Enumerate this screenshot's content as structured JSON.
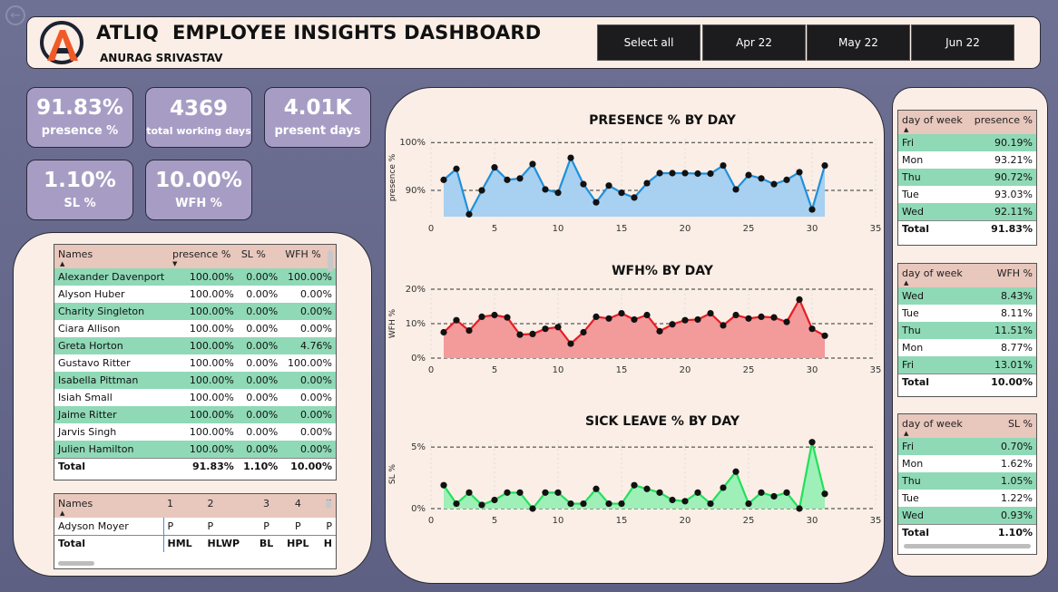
{
  "header": {
    "title": "ATLIQ  EMPLOYEE INSIGHTS DASHBOARD",
    "author": "ANURAG SRIVASTAV",
    "slicers": [
      "Select all",
      "Apr 22",
      "May 22",
      "Jun 22"
    ]
  },
  "kpis": [
    {
      "value": "91.83%",
      "label": "presence %"
    },
    {
      "value": "4369",
      "label": "total working days"
    },
    {
      "value": "4.01K",
      "label": "present days"
    },
    {
      "value": "1.10%",
      "label": "SL %"
    },
    {
      "value": "10.00%",
      "label": "WFH %"
    }
  ],
  "employee_table": {
    "columns": [
      "Names",
      "presence %",
      "SL %",
      "WFH %"
    ],
    "rows": [
      [
        "Alexander Davenport",
        "100.00%",
        "0.00%",
        "100.00%"
      ],
      [
        "Alyson Huber",
        "100.00%",
        "0.00%",
        "0.00%"
      ],
      [
        "Charity Singleton",
        "100.00%",
        "0.00%",
        "0.00%"
      ],
      [
        "Ciara Allison",
        "100.00%",
        "0.00%",
        "0.00%"
      ],
      [
        "Greta Horton",
        "100.00%",
        "0.00%",
        "4.76%"
      ],
      [
        "Gustavo Ritter",
        "100.00%",
        "0.00%",
        "100.00%"
      ],
      [
        "Isabella Pittman",
        "100.00%",
        "0.00%",
        "0.00%"
      ],
      [
        "Isiah Small",
        "100.00%",
        "0.00%",
        "0.00%"
      ],
      [
        "Jaime Ritter",
        "100.00%",
        "0.00%",
        "0.00%"
      ],
      [
        "Jarvis Singh",
        "100.00%",
        "0.00%",
        "0.00%"
      ],
      [
        "Julien Hamilton",
        "100.00%",
        "0.00%",
        "0.00%"
      ]
    ],
    "total": [
      "Total",
      "91.83%",
      "1.10%",
      "10.00%"
    ]
  },
  "attendance_matrix": {
    "columns": [
      "Names",
      "1",
      "2",
      "3",
      "4",
      "5"
    ],
    "rows": [
      [
        "Adyson Moyer",
        "P",
        "P",
        "P",
        "P",
        "P"
      ]
    ],
    "total": [
      "Total",
      "HML",
      "HLWP",
      "BL",
      "HPL",
      "H"
    ]
  },
  "dow_tables": [
    {
      "columns": [
        "day of week",
        "presence %"
      ],
      "rows": [
        [
          "Fri",
          "90.19%"
        ],
        [
          "Mon",
          "93.21%"
        ],
        [
          "Thu",
          "90.72%"
        ],
        [
          "Tue",
          "93.03%"
        ],
        [
          "Wed",
          "92.11%"
        ]
      ],
      "total": [
        "Total",
        "91.83%"
      ]
    },
    {
      "columns": [
        "day of week",
        "WFH %"
      ],
      "rows": [
        [
          "Wed",
          "8.43%"
        ],
        [
          "Tue",
          "8.11%"
        ],
        [
          "Thu",
          "11.51%"
        ],
        [
          "Mon",
          "8.77%"
        ],
        [
          "Fri",
          "13.01%"
        ]
      ],
      "total": [
        "Total",
        "10.00%"
      ]
    },
    {
      "columns": [
        "day of week",
        "SL %"
      ],
      "rows": [
        [
          "Fri",
          "0.70%"
        ],
        [
          "Mon",
          "1.62%"
        ],
        [
          "Thu",
          "1.05%"
        ],
        [
          "Tue",
          "1.22%"
        ],
        [
          "Wed",
          "0.93%"
        ]
      ],
      "total": [
        "Total",
        "1.10%"
      ]
    }
  ],
  "chart_data": [
    {
      "type": "area",
      "title": "PRESENCE % BY DAY",
      "ylabel": "presence %",
      "xlabel": "",
      "xticks": [
        0,
        5,
        10,
        15,
        20,
        25,
        30,
        35
      ],
      "yticks": [
        {
          "v": 90,
          "label": "90%"
        },
        {
          "v": 100,
          "label": "100%"
        }
      ],
      "xlim": [
        0,
        35
      ],
      "ylim": [
        84.5,
        100.8
      ],
      "grid": "horizontal dashed",
      "color": "#1e90dc",
      "fill": "#a8d0f0",
      "x": [
        1,
        2,
        3,
        4,
        5,
        6,
        7,
        8,
        9,
        10,
        11,
        12,
        13,
        14,
        15,
        16,
        17,
        18,
        19,
        20,
        21,
        22,
        23,
        24,
        25,
        26,
        27,
        28,
        29,
        30,
        31
      ],
      "values": [
        92.2,
        94.5,
        85.0,
        90.0,
        94.8,
        92.2,
        92.5,
        95.5,
        90.2,
        89.5,
        96.8,
        91.3,
        87.5,
        91.0,
        89.5,
        88.5,
        91.5,
        93.6,
        93.6,
        93.6,
        93.5,
        93.5,
        95.2,
        90.2,
        93.2,
        92.5,
        91.3,
        92.2,
        93.8,
        86.0,
        95.2
      ]
    },
    {
      "type": "area",
      "title": "WFH% BY DAY",
      "ylabel": "WFH %",
      "xlabel": "",
      "xticks": [
        0,
        5,
        10,
        15,
        20,
        25,
        30,
        35
      ],
      "yticks": [
        {
          "v": 0,
          "label": "0%"
        },
        {
          "v": 10,
          "label": "10%"
        },
        {
          "v": 20,
          "label": "20%"
        }
      ],
      "xlim": [
        0,
        35
      ],
      "ylim": [
        0,
        20
      ],
      "grid": "horizontal dashed",
      "color": "#e81c24",
      "fill": "#f39a9a",
      "x": [
        1,
        2,
        3,
        4,
        5,
        6,
        7,
        8,
        9,
        10,
        11,
        12,
        13,
        14,
        15,
        16,
        17,
        18,
        19,
        20,
        21,
        22,
        23,
        24,
        25,
        26,
        27,
        28,
        29,
        30,
        31
      ],
      "values": [
        7.5,
        11.0,
        8.0,
        12.0,
        12.5,
        11.8,
        6.8,
        7.0,
        8.5,
        9.0,
        4.2,
        7.5,
        12.0,
        11.5,
        13.0,
        11.2,
        12.5,
        7.8,
        9.8,
        11.0,
        11.2,
        13.0,
        9.5,
        12.5,
        11.5,
        12.0,
        11.8,
        10.5,
        17.0,
        8.5,
        6.5
      ]
    },
    {
      "type": "area",
      "title": "SICK LEAVE % BY DAY",
      "ylabel": "SL %",
      "xlabel": "",
      "xticks": [
        0,
        5,
        10,
        15,
        20,
        25,
        30,
        35
      ],
      "yticks": [
        {
          "v": 0,
          "label": "0%"
        },
        {
          "v": 5,
          "label": "5%"
        }
      ],
      "xlim": [
        0,
        35
      ],
      "ylim": [
        0,
        5.6
      ],
      "grid": "horizontal dashed",
      "color": "#22e05a",
      "fill": "#9ef0b8",
      "x": [
        1,
        2,
        3,
        4,
        5,
        6,
        7,
        8,
        9,
        10,
        11,
        12,
        13,
        14,
        15,
        16,
        17,
        18,
        19,
        20,
        21,
        22,
        23,
        24,
        25,
        26,
        27,
        28,
        29,
        30,
        31
      ],
      "values": [
        1.9,
        0.4,
        1.3,
        0.3,
        0.7,
        1.3,
        1.3,
        0.0,
        1.3,
        1.3,
        0.4,
        0.4,
        1.6,
        0.4,
        0.4,
        1.9,
        1.6,
        1.3,
        0.7,
        0.6,
        1.3,
        0.4,
        1.7,
        3.0,
        0.4,
        1.3,
        1.0,
        1.3,
        0.0,
        5.4,
        1.2
      ]
    }
  ]
}
